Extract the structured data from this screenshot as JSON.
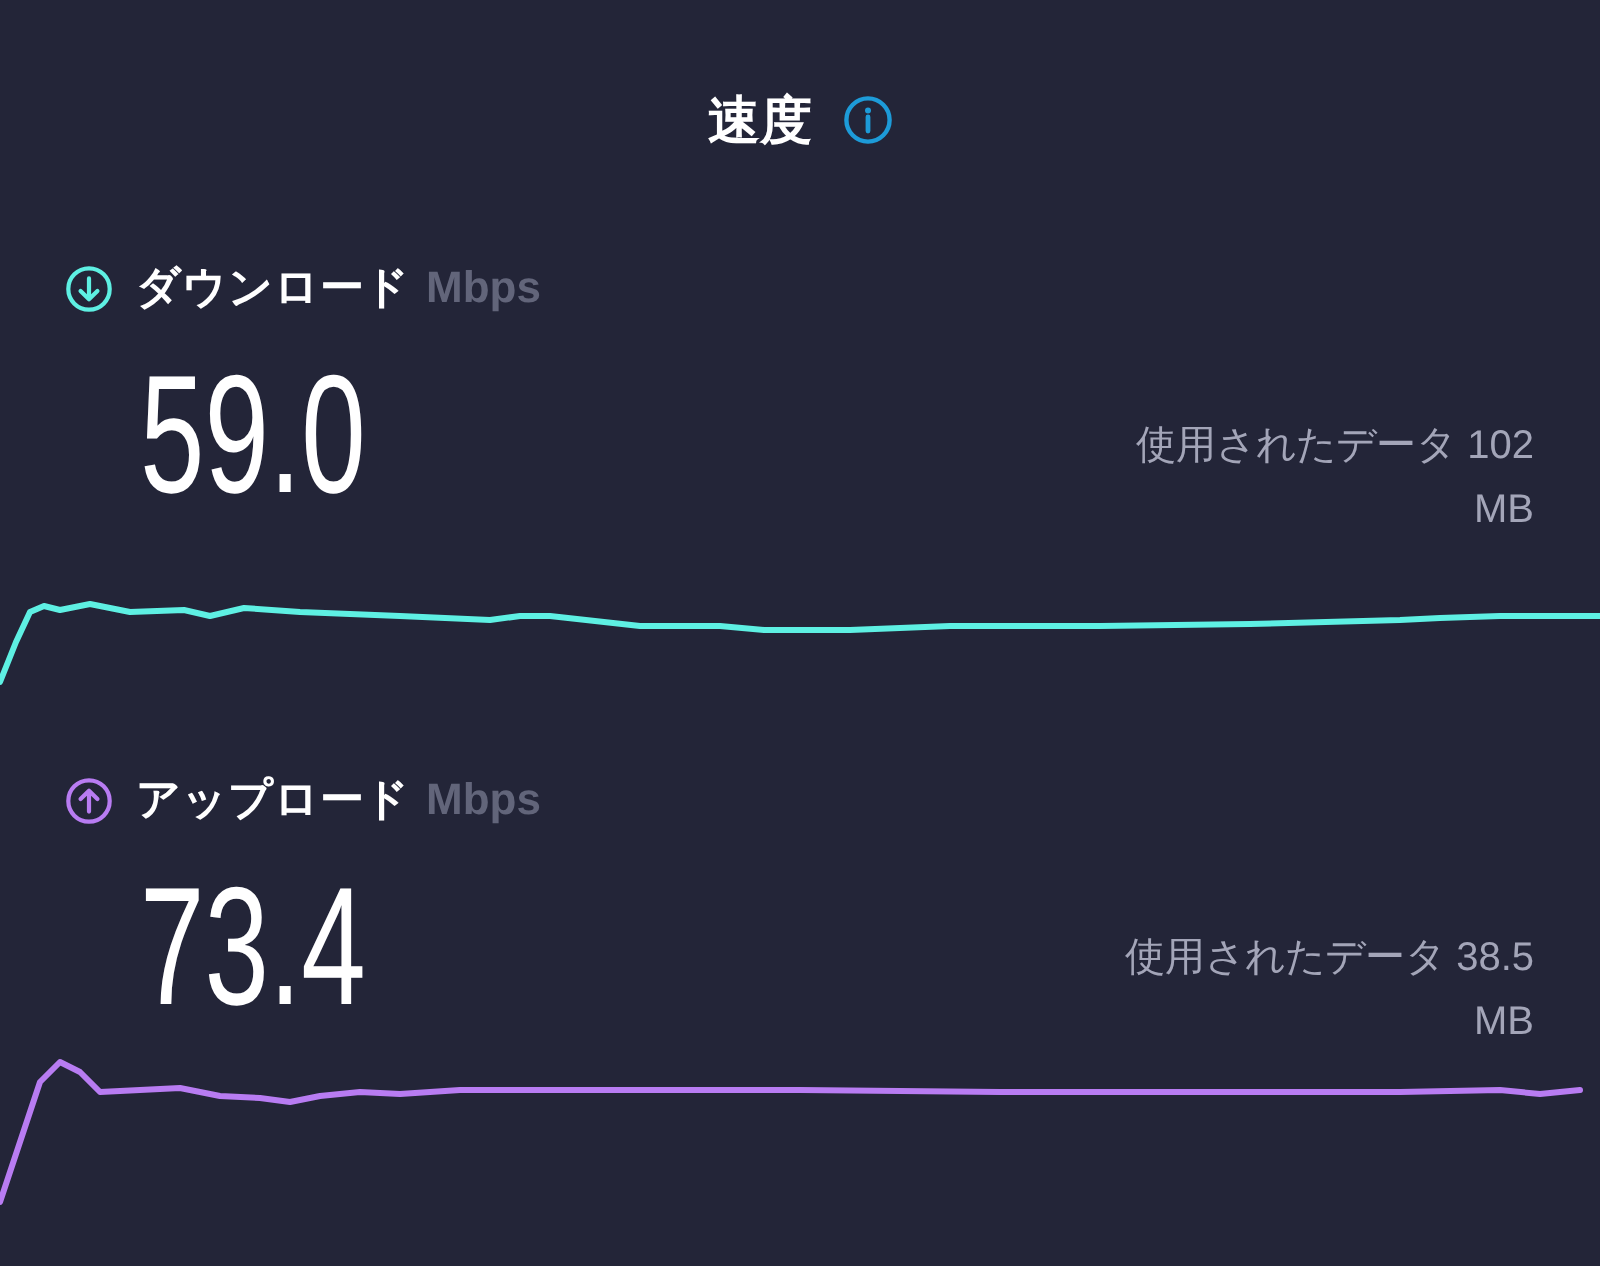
{
  "header": {
    "title": "速度"
  },
  "tests": [
    {
      "kind": "download",
      "label": "ダウンロード",
      "unit": "Mbps",
      "speed": "59.0",
      "data_used": "使用されたデータ 102 MB",
      "color": "#5ef0e3"
    },
    {
      "kind": "upload",
      "label": "アップロード",
      "unit": "Mbps",
      "speed": "73.4",
      "data_used": "使用されたデータ 38.5 MB",
      "color": "#b87cf2"
    }
  ]
}
